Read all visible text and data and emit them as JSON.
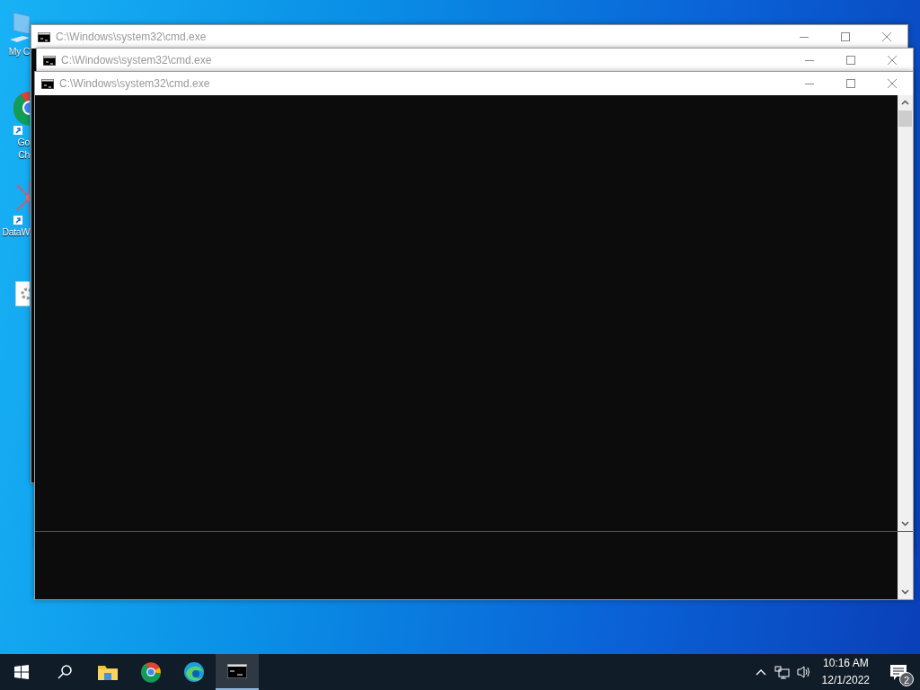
{
  "desktop_icons": [
    {
      "kind": "computer",
      "label_lines": [
        "My C"
      ]
    },
    {
      "kind": "chrome",
      "label_lines": [
        "Go",
        "Ch"
      ]
    },
    {
      "kind": "network",
      "label_lines": [
        "DataW"
      ]
    },
    {
      "kind": "settings"
    }
  ],
  "windows": [
    {
      "title": "C:\\Windows\\system32\\cmd.exe",
      "active": false
    },
    {
      "title": "C:\\Windows\\system32\\cmd.exe",
      "active": false
    },
    {
      "title": "C:\\Windows\\system32\\cmd.exe",
      "active": false,
      "split_console": true
    }
  ],
  "taskbar": {
    "apps": [
      {
        "kind": "start",
        "selected": false
      },
      {
        "kind": "search",
        "selected": false
      },
      {
        "kind": "explorer",
        "selected": false
      },
      {
        "kind": "chrome",
        "selected": false
      },
      {
        "kind": "edge",
        "selected": false
      },
      {
        "kind": "cmd",
        "selected": true
      }
    ],
    "time": "10:16 AM",
    "date": "12/1/2022",
    "notification_count": "2"
  }
}
